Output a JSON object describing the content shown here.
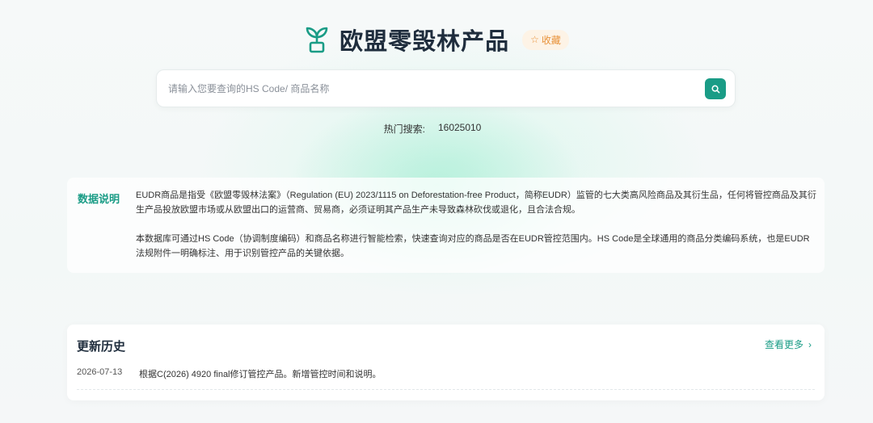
{
  "header": {
    "title": "欧盟零毁林产品",
    "favorite_label": "收藏"
  },
  "search": {
    "placeholder": "请输入您要查询的HS Code/ 商品名称",
    "value": ""
  },
  "hot_search": {
    "label": "热门搜索:",
    "items": [
      "16025010"
    ]
  },
  "description": {
    "title": "数据说明",
    "paragraphs": [
      "EUDR商品是指受《欧盟零毁林法案》（Regulation (EU) 2023/1115 on Deforestation-free Product，简称EUDR）监管的七大类高风险商品及其衍生品，任何将管控商品及其衍生产品投放欧盟市场或从欧盟出口的运营商、贸易商，必须证明其产品生产未导致森林砍伐或退化，且合法合规。",
      "本数据库可通过HS Code（协调制度编码）和商品名称进行智能检索，快速查询对应的商品是否在EUDR管控范围内。HS Code是全球通用的商品分类编码系统，也是EUDR法规附件一明确标注、用于识别管控产品的关键依据。"
    ]
  },
  "history": {
    "title": "更新历史",
    "more_label": "查看更多",
    "entries": [
      {
        "date": "2026-07-13",
        "text": "根据C(2026) 4920 final修订管控产品。新增管控时间和说明。"
      }
    ]
  },
  "colors": {
    "accent": "#1a9c86",
    "favorite": "#e8923a",
    "favorite_bg": "#fdf3e6",
    "title": "#1f2d3d"
  },
  "icons": {
    "logo": "sprout-icon",
    "favorite": "star-icon",
    "search": "search-icon",
    "more": "chevron-right-icon"
  }
}
